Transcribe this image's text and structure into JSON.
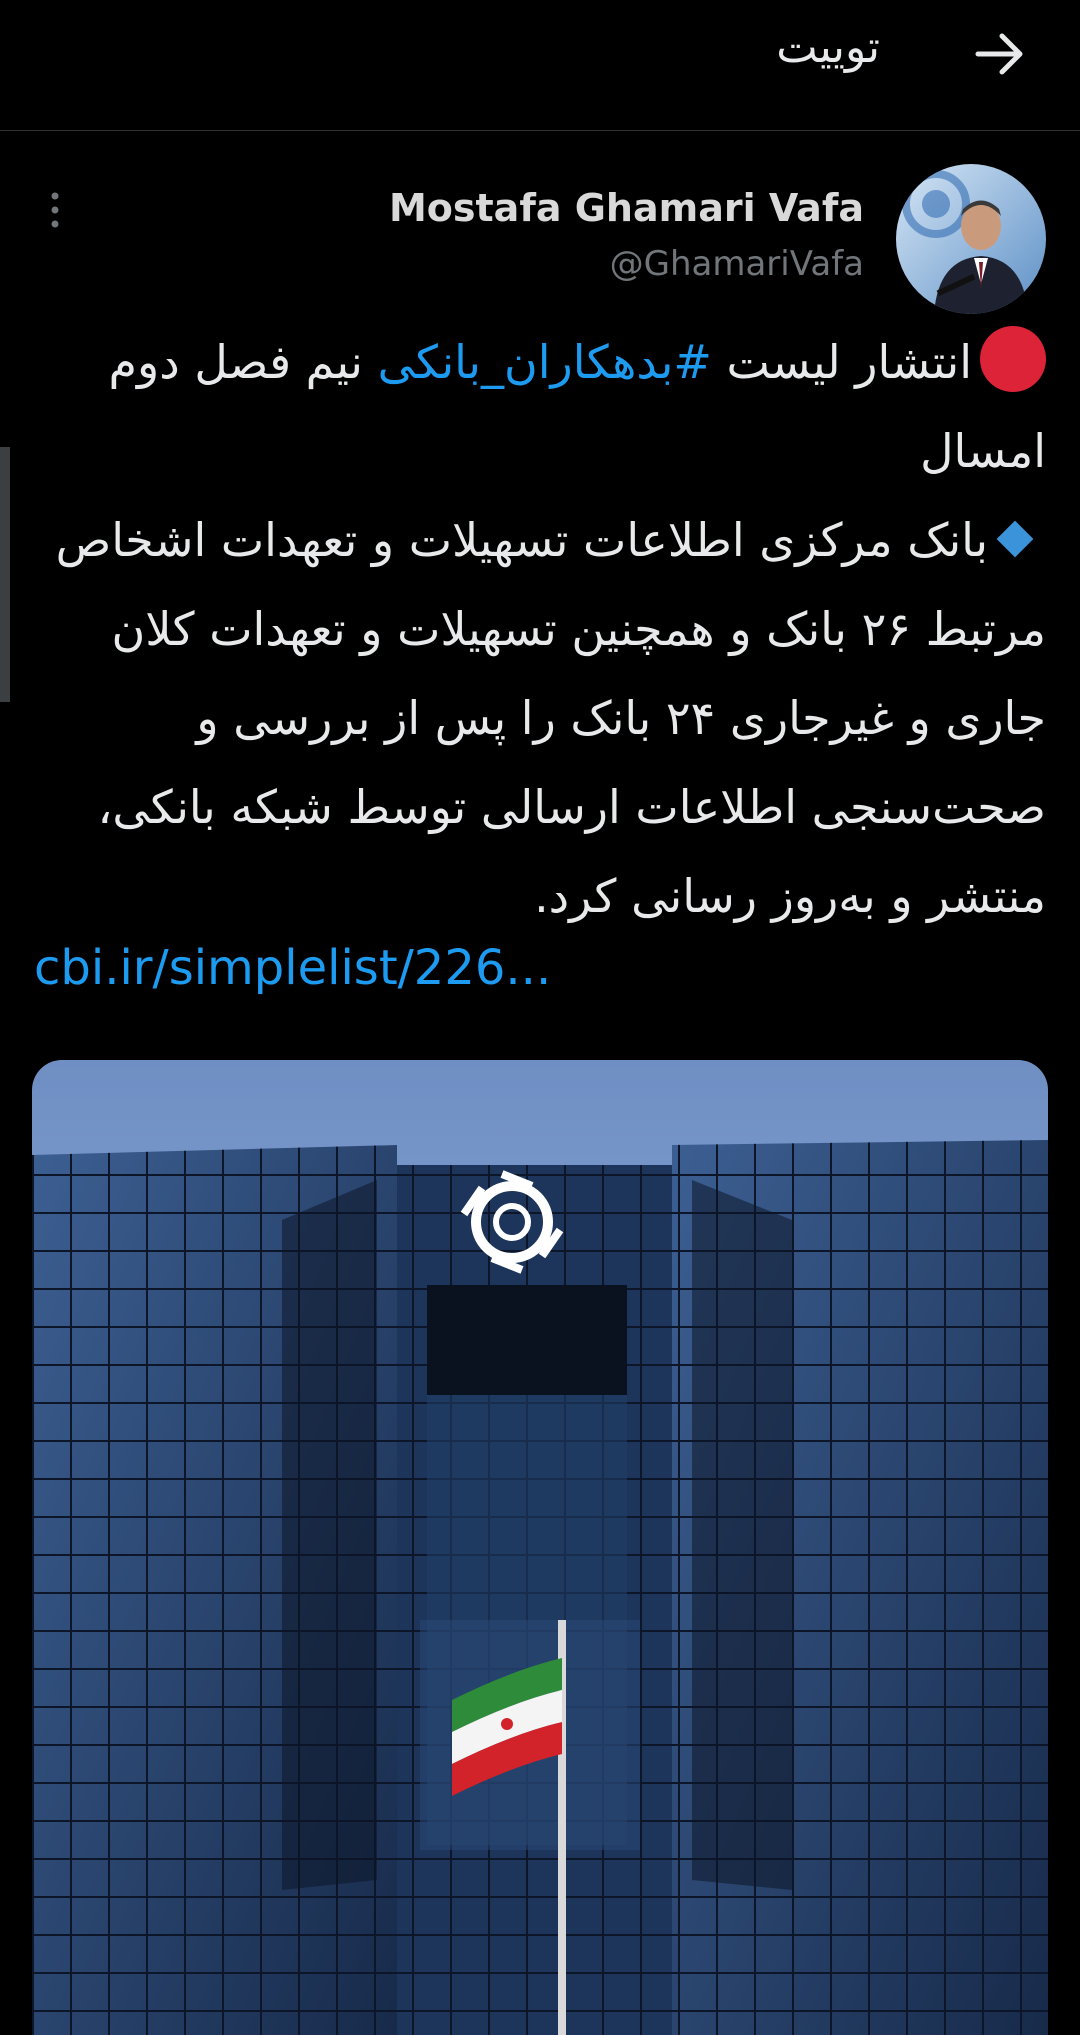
{
  "header": {
    "title": "توییت",
    "back_icon": "arrow-right-icon"
  },
  "tweet": {
    "author": {
      "display_name": "Mostafa Ghamari Vafa",
      "handle": "@GhamariVafa",
      "avatar_icon": "avatar"
    },
    "more_icon": "more-vertical-icon",
    "line1_prefix": "انتشار لیست ",
    "hashtag": "#بدهکاران_بانکی",
    "line1_suffix": " نیم فصل دوم امسال",
    "paragraph2": "بانک مرکزی اطلاعات تسهیلات و تعهدات اشخاص مرتبط ۲۶ بانک و همچنین تسهیلات و تعهدات کلان جاری و غیرجاری ۲۴ بانک را پس از بررسی و صحت‌سنجی اطلاعات ارسالی توسط شبکه بانکی، منتشر و به‌روز رسانی کرد.",
    "link": "cbi.ir/simplelist/226...",
    "media_description_icon": "building-photo"
  },
  "colors": {
    "background": "#000000",
    "text": "#e7e9ea",
    "muted": "#71767b",
    "link": "#1d9bf0",
    "red_dot": "#dc2338",
    "diamond": "#3b94d9"
  }
}
